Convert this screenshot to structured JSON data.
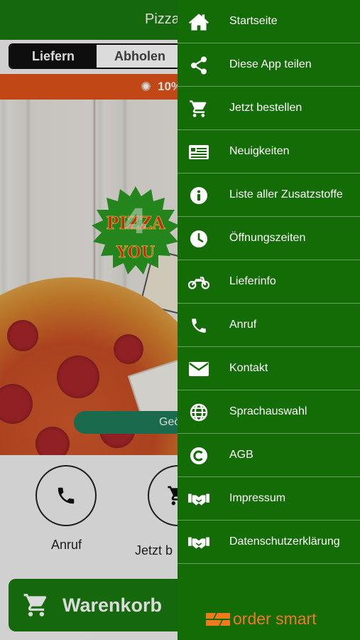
{
  "app": {
    "title": "Pizza",
    "order_modes": [
      {
        "label": "Liefern",
        "active": true
      },
      {
        "label": "Abholen",
        "active": false
      }
    ],
    "promo_text": "10%",
    "geo_button_label": "Geö",
    "actions": [
      {
        "label": "Anruf",
        "icon": "phone-icon"
      },
      {
        "label": "Jetzt b",
        "icon": "cart-icon"
      }
    ],
    "cart_button_label": "Warenkorb"
  },
  "drawer": {
    "items": [
      {
        "label": "Startseite",
        "icon": "home-icon"
      },
      {
        "label": "Diese App teilen",
        "icon": "share-icon"
      },
      {
        "label": "Jetzt bestellen",
        "icon": "cart-icon"
      },
      {
        "label": "Neuigkeiten",
        "icon": "news-icon"
      },
      {
        "label": "Liste aller Zusatzstoffe",
        "icon": "info-icon"
      },
      {
        "label": "Öffnungszeiten",
        "icon": "clock-icon"
      },
      {
        "label": "Lieferinfo",
        "icon": "motorcycle-icon"
      },
      {
        "label": "Anruf",
        "icon": "phone-icon"
      },
      {
        "label": "Kontakt",
        "icon": "envelope-icon"
      },
      {
        "label": "Sprachauswahl",
        "icon": "globe-icon"
      },
      {
        "label": "AGB",
        "icon": "copyright-icon"
      },
      {
        "label": "Impressum",
        "icon": "handshake-icon"
      },
      {
        "label": "Datenschutzerklärung",
        "icon": "handshake-icon"
      }
    ],
    "brand": "order smart"
  },
  "colors": {
    "header_green": "#1a7a0f",
    "drawer_green": "#136c06",
    "promo_orange": "#e2531b",
    "brand_orange": "#f07a1a"
  }
}
